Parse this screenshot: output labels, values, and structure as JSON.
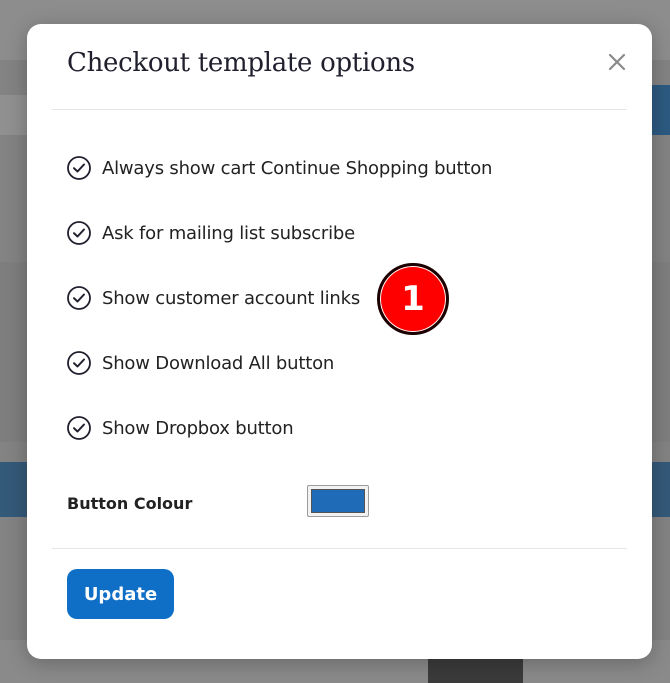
{
  "modal": {
    "title": "Checkout template options",
    "close_icon": "close-icon"
  },
  "options": [
    {
      "label": "Always show cart Continue Shopping button",
      "checked": true
    },
    {
      "label": "Ask for mailing list subscribe",
      "checked": true
    },
    {
      "label": "Show customer account links",
      "checked": true
    },
    {
      "label": "Show Download All button",
      "checked": true
    },
    {
      "label": "Show Dropbox button",
      "checked": true
    }
  ],
  "button_colour": {
    "label": "Button Colour",
    "value": "#1f6bb8"
  },
  "update_button": {
    "label": "Update",
    "color": "#0f6fc6"
  },
  "annotation_marker": {
    "label": "1"
  }
}
